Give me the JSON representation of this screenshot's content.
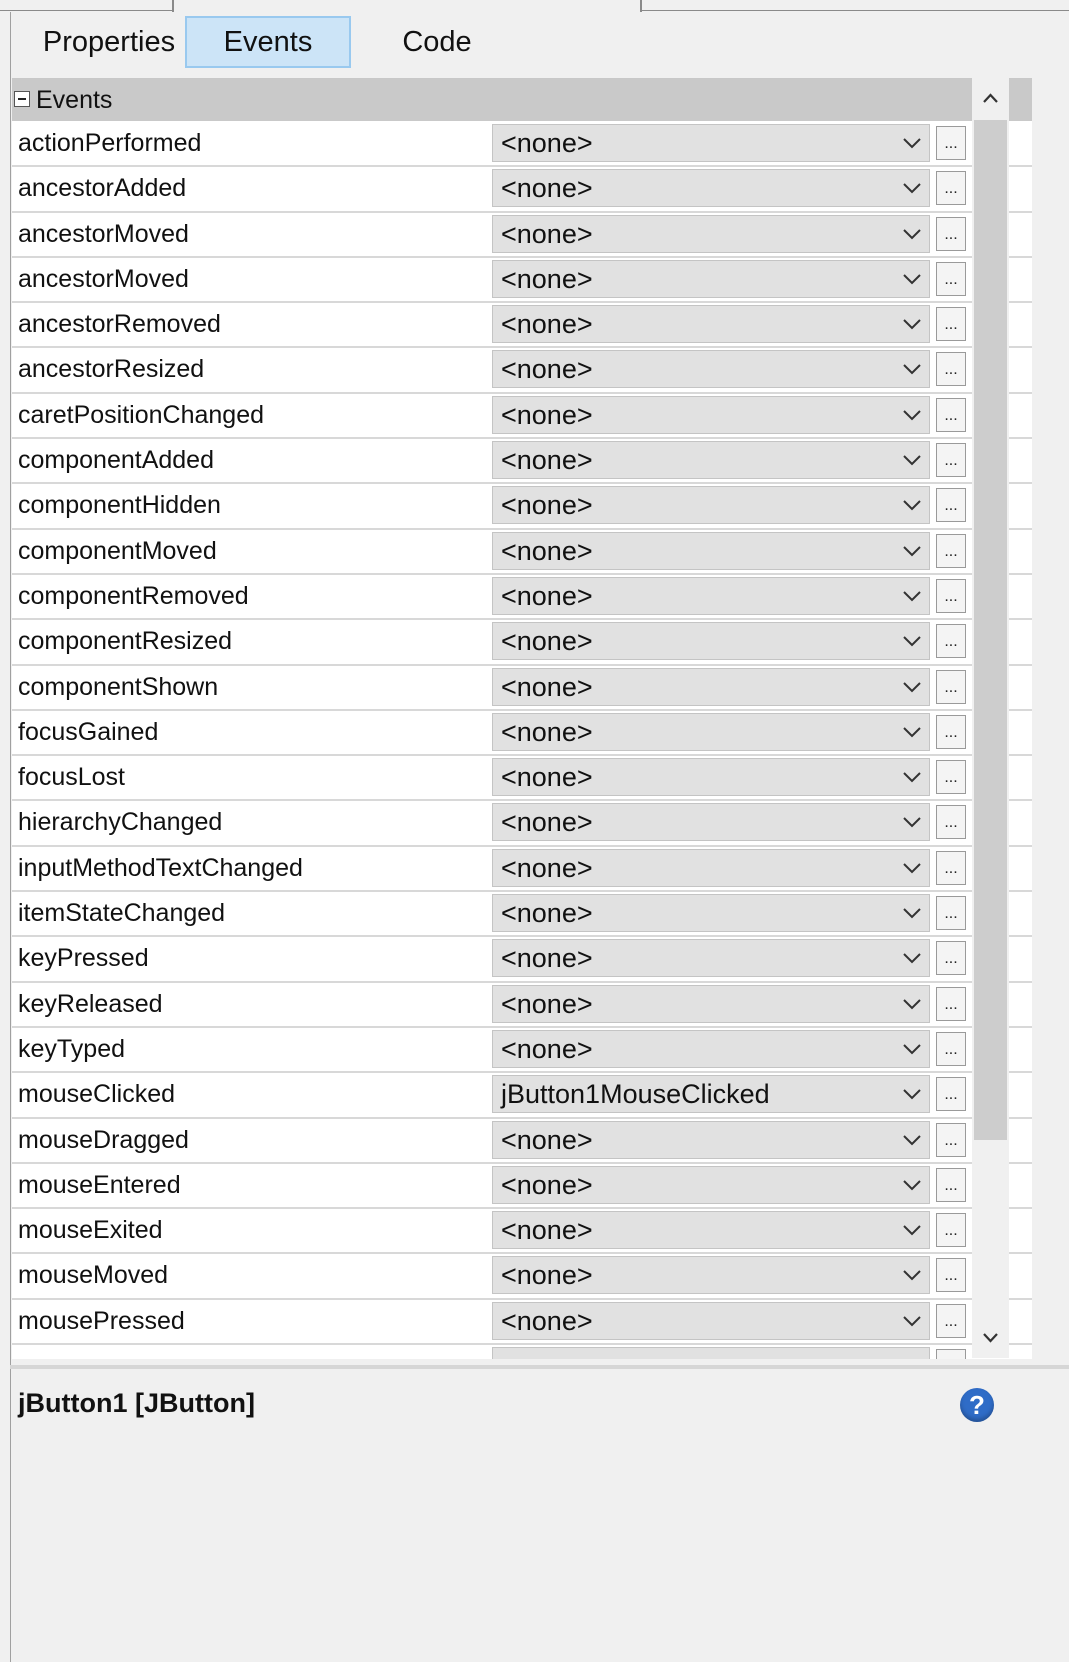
{
  "tabs": [
    {
      "label": "Properties",
      "active": false
    },
    {
      "label": "Events",
      "active": true
    },
    {
      "label": "Code",
      "active": false
    }
  ],
  "category": {
    "label": "Events",
    "expanded": true
  },
  "events": [
    {
      "name": "actionPerformed",
      "value": "<none>"
    },
    {
      "name": "ancestorAdded",
      "value": "<none>"
    },
    {
      "name": "ancestorMoved",
      "value": "<none>"
    },
    {
      "name": "ancestorMoved",
      "value": "<none>"
    },
    {
      "name": "ancestorRemoved",
      "value": "<none>"
    },
    {
      "name": "ancestorResized",
      "value": "<none>"
    },
    {
      "name": "caretPositionChanged",
      "value": "<none>"
    },
    {
      "name": "componentAdded",
      "value": "<none>"
    },
    {
      "name": "componentHidden",
      "value": "<none>"
    },
    {
      "name": "componentMoved",
      "value": "<none>"
    },
    {
      "name": "componentRemoved",
      "value": "<none>"
    },
    {
      "name": "componentResized",
      "value": "<none>"
    },
    {
      "name": "componentShown",
      "value": "<none>"
    },
    {
      "name": "focusGained",
      "value": "<none>"
    },
    {
      "name": "focusLost",
      "value": "<none>"
    },
    {
      "name": "hierarchyChanged",
      "value": "<none>"
    },
    {
      "name": "inputMethodTextChanged",
      "value": "<none>"
    },
    {
      "name": "itemStateChanged",
      "value": "<none>"
    },
    {
      "name": "keyPressed",
      "value": "<none>"
    },
    {
      "name": "keyReleased",
      "value": "<none>"
    },
    {
      "name": "keyTyped",
      "value": "<none>"
    },
    {
      "name": "mouseClicked",
      "value": "jButton1MouseClicked"
    },
    {
      "name": "mouseDragged",
      "value": "<none>"
    },
    {
      "name": "mouseEntered",
      "value": "<none>"
    },
    {
      "name": "mouseExited",
      "value": "<none>"
    },
    {
      "name": "mouseMoved",
      "value": "<none>"
    },
    {
      "name": "mousePressed",
      "value": "<none>"
    }
  ],
  "ellipsis_label": "...",
  "description": {
    "title": "jButton1 [JButton]"
  },
  "help_icon": "help-icon",
  "colors": {
    "active_tab": "#cce4f7",
    "category_bg": "#c9c9c9",
    "help": "#2f6cc7"
  }
}
